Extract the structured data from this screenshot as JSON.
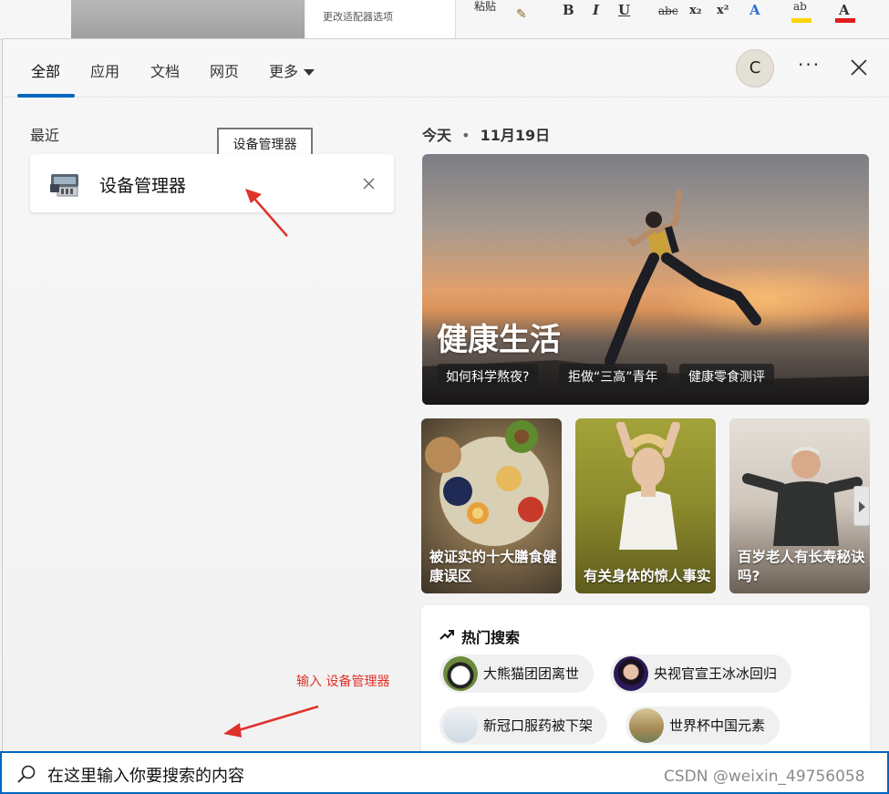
{
  "background_app": {
    "caption": "更改适配器选项",
    "paste_label": "粘贴",
    "format_buttons": [
      "B",
      "I",
      "U",
      "abc",
      "x₂",
      "x²",
      "A",
      "ab",
      "A"
    ]
  },
  "tabs": [
    {
      "label": "全部",
      "active": true
    },
    {
      "label": "应用"
    },
    {
      "label": "文档"
    },
    {
      "label": "网页"
    },
    {
      "label": "更多"
    }
  ],
  "user_avatar": {
    "initial": "C"
  },
  "more_label": "···",
  "recent": {
    "title": "最近",
    "tooltip": "设备管理器",
    "items": [
      {
        "label": "设备管理器",
        "icon": "device-manager-icon"
      }
    ]
  },
  "annotation": {
    "text": "输入 设备管理器",
    "color": "#e0322a"
  },
  "today": {
    "label": "今天",
    "separator": "•",
    "date": "11月19日"
  },
  "hero": {
    "title": "健康生活",
    "chips": [
      "如何科学熬夜?",
      "拒做“三高”青年",
      "健康零食测评"
    ]
  },
  "cards": [
    {
      "text": "被证实的十大膳食健康误区"
    },
    {
      "text": "有关身体的惊人事实"
    },
    {
      "text": "百岁老人有长寿秘诀吗?"
    }
  ],
  "trending": {
    "title": "热门搜索",
    "items": [
      "大熊猫团团离世",
      "央视官宣王冰冰回归",
      "新冠口服药被下架",
      "世界杯中国元素"
    ]
  },
  "search": {
    "placeholder": "在这里输入你要搜索的内容"
  },
  "watermark": "CSDN @weixin_49756058",
  "colors": {
    "accent": "#0067c0",
    "annotation_red": "#e0322a"
  }
}
